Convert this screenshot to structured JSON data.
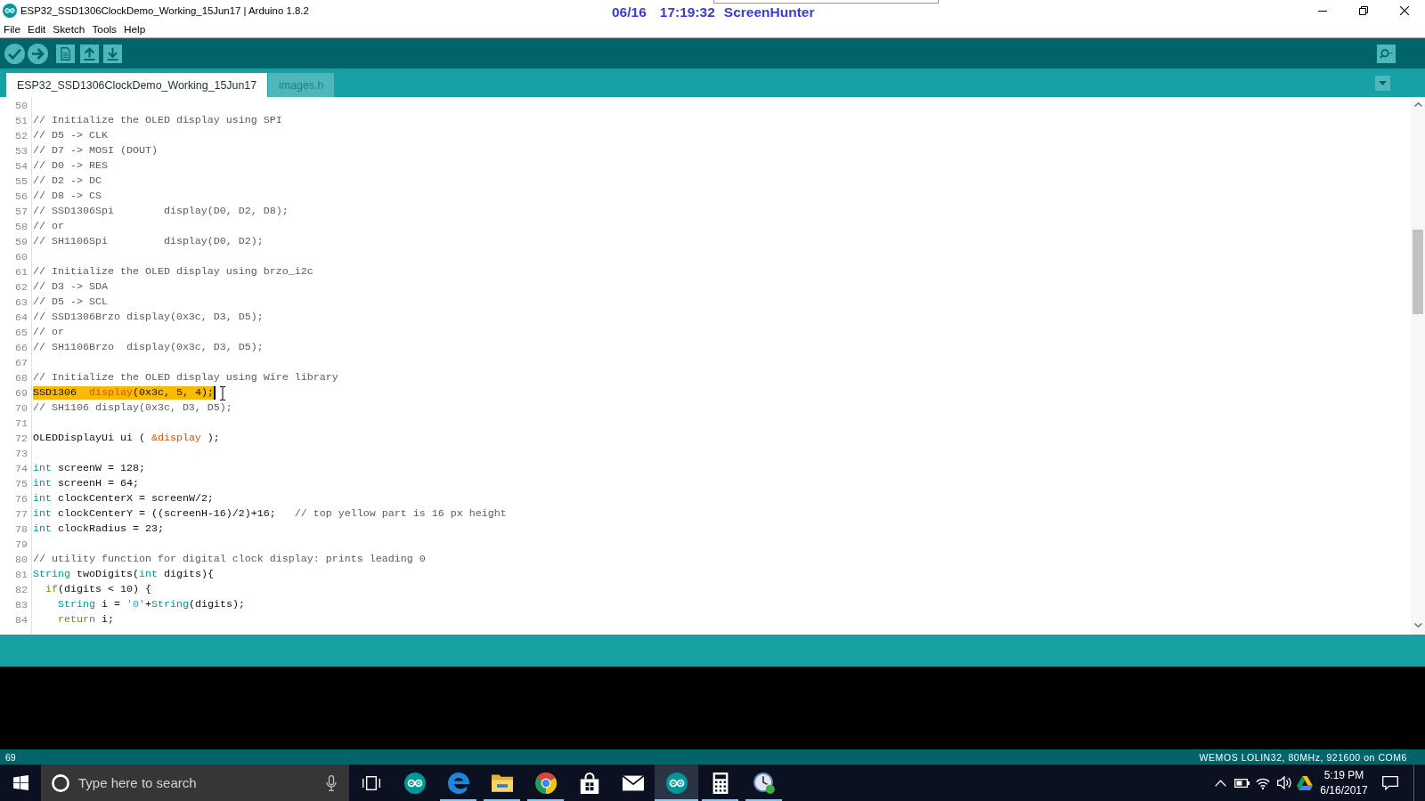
{
  "window": {
    "title": "ESP32_SSD1306ClockDemo_Working_15Jun17 | Arduino 1.8.2"
  },
  "capture_stamp": {
    "date": "06/16",
    "time": "17:19:32",
    "label": "ScreenHunter"
  },
  "menu": [
    "File",
    "Edit",
    "Sketch",
    "Tools",
    "Help"
  ],
  "tabs": [
    {
      "label": "ESP32_SSD1306ClockDemo_Working_15Jun17",
      "selected": true
    },
    {
      "label": "images.h",
      "selected": false
    }
  ],
  "editor": {
    "lines": [
      {
        "number": "50",
        "highlighted": false
      },
      {
        "number": "51",
        "highlighted": false,
        "segments": [
          {
            "kind": "comment",
            "text": "// Initialize the OLED display using SPI"
          }
        ]
      },
      {
        "number": "52",
        "highlighted": false,
        "segments": [
          {
            "kind": "comment",
            "text": "// D5 -> CLK"
          }
        ]
      },
      {
        "number": "53",
        "highlighted": false,
        "segments": [
          {
            "kind": "comment",
            "text": "// D7 -> MOSI (DOUT)"
          }
        ]
      },
      {
        "number": "54",
        "highlighted": false,
        "segments": [
          {
            "kind": "comment",
            "text": "// D0 -> RES"
          }
        ]
      },
      {
        "number": "55",
        "highlighted": false,
        "segments": [
          {
            "kind": "comment",
            "text": "// D2 -> DC"
          }
        ]
      },
      {
        "number": "56",
        "highlighted": false,
        "segments": [
          {
            "kind": "comment",
            "text": "// D8 -> CS"
          }
        ]
      },
      {
        "number": "57",
        "highlighted": false,
        "segments": [
          {
            "kind": "comment",
            "text": "// SSD1306Spi        display(D0, D2, D8);"
          }
        ]
      },
      {
        "number": "58",
        "highlighted": false,
        "segments": [
          {
            "kind": "comment",
            "text": "// or"
          }
        ]
      },
      {
        "number": "59",
        "highlighted": false,
        "segments": [
          {
            "kind": "comment",
            "text": "// SH1106Spi         display(D0, D2);"
          }
        ]
      },
      {
        "number": "60",
        "highlighted": false
      },
      {
        "number": "61",
        "highlighted": false,
        "segments": [
          {
            "kind": "comment",
            "text": "// Initialize the OLED display using brzo_i2c"
          }
        ]
      },
      {
        "number": "62",
        "highlighted": false,
        "segments": [
          {
            "kind": "comment",
            "text": "// D3 -> SDA"
          }
        ]
      },
      {
        "number": "63",
        "highlighted": false,
        "segments": [
          {
            "kind": "comment",
            "text": "// D5 -> SCL"
          }
        ]
      },
      {
        "number": "64",
        "highlighted": false,
        "segments": [
          {
            "kind": "comment",
            "text": "// SSD1306Brzo display(0x3c, D3, D5);"
          }
        ]
      },
      {
        "number": "65",
        "highlighted": false,
        "segments": [
          {
            "kind": "comment",
            "text": "// or"
          }
        ]
      },
      {
        "number": "66",
        "highlighted": false,
        "segments": [
          {
            "kind": "comment",
            "text": "// SH1106Brzo  display(0x3c, D3, D5);"
          }
        ]
      },
      {
        "number": "67",
        "highlighted": false
      },
      {
        "number": "68",
        "highlighted": false,
        "segments": [
          {
            "kind": "comment",
            "text": "// Initialize the OLED display using Wire library"
          }
        ]
      },
      {
        "number": "69",
        "highlighted": true,
        "segments": [
          {
            "kind": "plain",
            "text": "SSD1306  "
          },
          {
            "kind": "function",
            "text": "display"
          },
          {
            "kind": "plain",
            "text": "(0x3c, 5, 4);"
          }
        ]
      },
      {
        "number": "70",
        "highlighted": false,
        "segments": [
          {
            "kind": "comment",
            "text": "// SH1106 display(0x3c, D3, D5);"
          }
        ]
      },
      {
        "number": "71",
        "highlighted": false
      },
      {
        "number": "72",
        "highlighted": false,
        "segments": [
          {
            "kind": "plain",
            "text": "OLEDDisplayUi ui ( "
          },
          {
            "kind": "function",
            "text": "&display"
          },
          {
            "kind": "plain",
            "text": " );"
          }
        ]
      },
      {
        "number": "73",
        "highlighted": false
      },
      {
        "number": "74",
        "highlighted": false,
        "segments": [
          {
            "kind": "type",
            "text": "int"
          },
          {
            "kind": "plain",
            "text": " screenW = 128;"
          }
        ]
      },
      {
        "number": "75",
        "highlighted": false,
        "segments": [
          {
            "kind": "type",
            "text": "int"
          },
          {
            "kind": "plain",
            "text": " screenH = 64;"
          }
        ]
      },
      {
        "number": "76",
        "highlighted": false,
        "segments": [
          {
            "kind": "type",
            "text": "int"
          },
          {
            "kind": "plain",
            "text": " clockCenterX = screenW/2;"
          }
        ]
      },
      {
        "number": "77",
        "highlighted": false,
        "segments": [
          {
            "kind": "type",
            "text": "int"
          },
          {
            "kind": "plain",
            "text": " clockCenterY = ((screenH-16)/2)+16;   "
          },
          {
            "kind": "comment",
            "text": "// top yellow part is 16 px height"
          }
        ]
      },
      {
        "number": "78",
        "highlighted": false,
        "segments": [
          {
            "kind": "type",
            "text": "int"
          },
          {
            "kind": "plain",
            "text": " clockRadius = 23;"
          }
        ]
      },
      {
        "number": "79",
        "highlighted": false
      },
      {
        "number": "80",
        "highlighted": false,
        "segments": [
          {
            "kind": "comment",
            "text": "// utility function for digital clock display: prints leading 0"
          }
        ]
      },
      {
        "number": "81",
        "highlighted": false,
        "segments": [
          {
            "kind": "type",
            "text": "String"
          },
          {
            "kind": "plain",
            "text": " twoDigits("
          },
          {
            "kind": "type",
            "text": "int"
          },
          {
            "kind": "plain",
            "text": " digits){"
          }
        ]
      },
      {
        "number": "82",
        "highlighted": false,
        "segments": [
          {
            "kind": "control",
            "text": "  if"
          },
          {
            "kind": "plain",
            "text": "(digits < 10) {"
          }
        ]
      },
      {
        "number": "83",
        "highlighted": false,
        "segments": [
          {
            "kind": "type",
            "text": "    String"
          },
          {
            "kind": "plain",
            "text": " i = "
          },
          {
            "kind": "literal",
            "text": "'0'"
          },
          {
            "kind": "plain",
            "text": "+"
          },
          {
            "kind": "type",
            "text": "String"
          },
          {
            "kind": "plain",
            "text": "(digits);"
          }
        ]
      },
      {
        "number": "84",
        "highlighted": false,
        "segments": [
          {
            "kind": "control",
            "text": "    return"
          },
          {
            "kind": "plain",
            "text": " i;"
          }
        ]
      }
    ]
  },
  "status_bar": {
    "line": "69",
    "board": "WEMOS LOLIN32, 80MHz, 921600 on COM6"
  },
  "taskbar": {
    "search": {
      "placeholder": "Type here to search"
    },
    "apps": [
      {
        "kind": "infinity",
        "running": false,
        "selected": false
      },
      {
        "kind": "letter",
        "running": true,
        "selected": false
      },
      {
        "kind": "folder",
        "running": true,
        "selected": false
      },
      {
        "kind": "wheel",
        "running": true,
        "selected": false
      },
      {
        "kind": "bag",
        "running": false,
        "selected": false
      },
      {
        "kind": "envelope",
        "running": false,
        "selected": false
      },
      {
        "kind": "infinity",
        "running": true,
        "selected": true
      },
      {
        "kind": "calculator",
        "running": true,
        "selected": false
      },
      {
        "kind": "clock",
        "running": true,
        "selected": false
      }
    ],
    "clock": {
      "time": "5:19 PM",
      "date": "6/16/2017"
    }
  }
}
